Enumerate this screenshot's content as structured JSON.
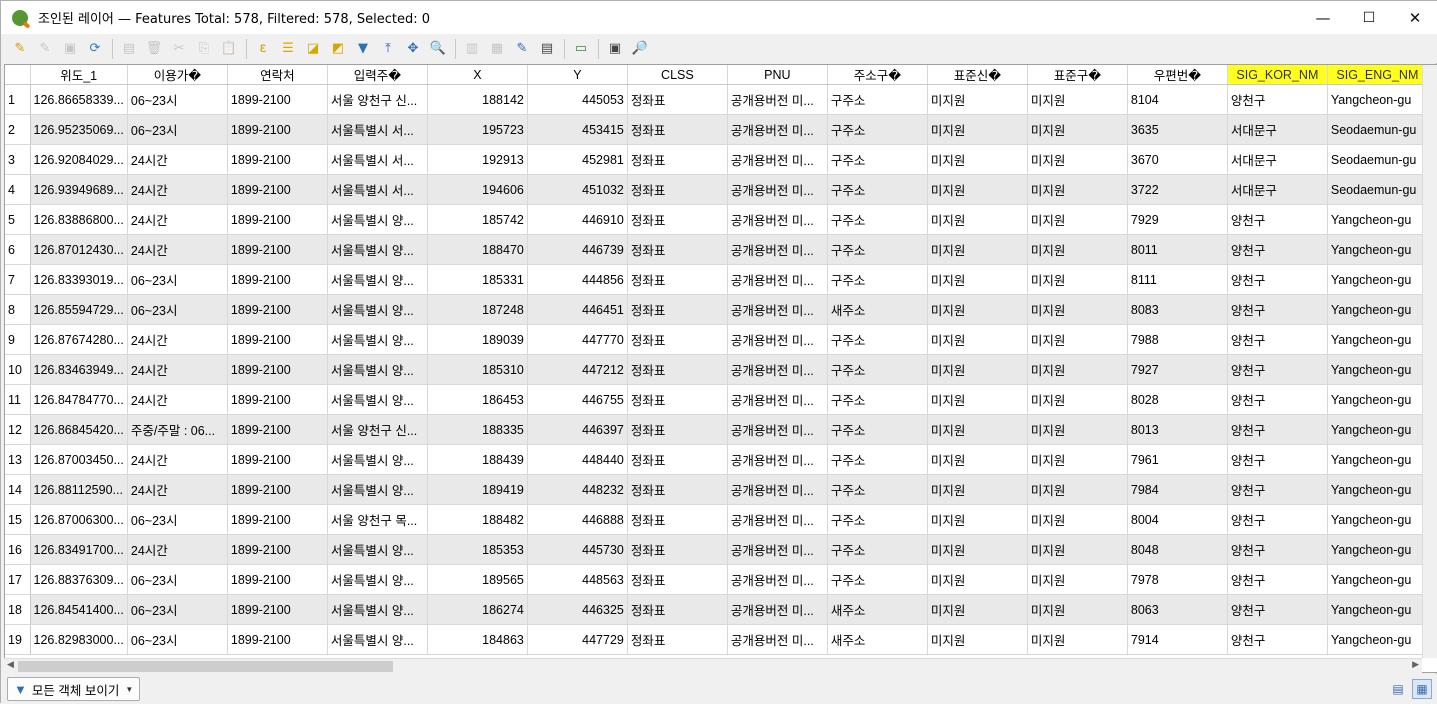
{
  "window": {
    "title": "조인된 레이어 — Features Total: 578, Filtered: 578, Selected: 0",
    "minimize": "—",
    "maximize": "☐",
    "close": "✕"
  },
  "toolbar": {
    "buttons": [
      {
        "name": "toggle-editing-icon",
        "glyph": "✎",
        "color": "#c8a000",
        "dim": false
      },
      {
        "name": "toggle-multi-edit-icon",
        "glyph": "✎",
        "color": "#777777",
        "dim": true
      },
      {
        "name": "save-edits-icon",
        "glyph": "▣",
        "color": "#777777",
        "dim": true
      },
      {
        "name": "reload-table-icon",
        "glyph": "⟳",
        "color": "#2a7ac8",
        "dim": false
      },
      {
        "sep": true
      },
      {
        "name": "add-feature-icon",
        "glyph": "▤",
        "color": "#777777",
        "dim": true
      },
      {
        "name": "delete-feature-icon",
        "glyph": "🗑",
        "color": "#777777",
        "dim": true
      },
      {
        "name": "cut-icon",
        "glyph": "✂",
        "color": "#777777",
        "dim": true
      },
      {
        "name": "copy-icon",
        "glyph": "⎘",
        "color": "#777777",
        "dim": true
      },
      {
        "name": "paste-icon",
        "glyph": "📋",
        "color": "#777777",
        "dim": true
      },
      {
        "sep": true
      },
      {
        "name": "select-by-expression-icon",
        "glyph": "ε",
        "color": "#c89a00",
        "dim": false
      },
      {
        "name": "select-all-icon",
        "glyph": "☰",
        "color": "#d4a800",
        "dim": false
      },
      {
        "name": "invert-selection-icon",
        "glyph": "◪",
        "color": "#d4a800",
        "dim": false
      },
      {
        "name": "deselect-all-icon",
        "glyph": "◩",
        "color": "#d4a800",
        "dim": false
      },
      {
        "name": "filter-select-icon",
        "glyph": "▼",
        "color": "#2d6fb8",
        "dim": false
      },
      {
        "name": "move-selection-top-icon",
        "glyph": "⤒",
        "color": "#2d6fb8",
        "dim": false
      },
      {
        "name": "pan-to-selected-icon",
        "glyph": "✥",
        "color": "#2d6fb8",
        "dim": false
      },
      {
        "name": "zoom-to-selected-icon",
        "glyph": "🔍",
        "color": "#c89a00",
        "dim": false
      },
      {
        "sep": true
      },
      {
        "name": "new-field-icon",
        "glyph": "▥",
        "color": "#777777",
        "dim": true
      },
      {
        "name": "delete-field-icon",
        "glyph": "▦",
        "color": "#777777",
        "dim": true
      },
      {
        "name": "field-calculator-icon",
        "glyph": "✎",
        "color": "#2d6fb8",
        "dim": false
      },
      {
        "name": "conditional-formatting-icon",
        "glyph": "▤",
        "color": "#444444",
        "dim": false
      },
      {
        "sep": true
      },
      {
        "name": "dock-table-icon",
        "glyph": "▭",
        "color": "#3c8a3c",
        "dim": false
      },
      {
        "sep": true
      },
      {
        "name": "actions-icon",
        "glyph": "▣",
        "color": "#444444",
        "dim": false
      },
      {
        "name": "identify-icon",
        "glyph": "🔎",
        "color": "#2d6fb8",
        "dim": false
      }
    ]
  },
  "table": {
    "columns": [
      "위도_1",
      "이용가�",
      "연락처",
      "입력주�",
      "X",
      "Y",
      "CLSS",
      "PNU",
      "주소구�",
      "표준신�",
      "표준구�",
      "우편번�",
      "SIG_KOR_NM",
      "SIG_ENG_NM"
    ],
    "highlighted_columns": [
      12,
      13
    ],
    "highlight_color": "#ffff20",
    "numeric_columns": [
      4,
      5
    ],
    "rows": [
      [
        "1",
        "126.86658339...",
        "06~23시",
        "1899-2100",
        "서울 양천구 신...",
        "188142",
        "445053",
        "정좌표",
        "공개용버전 미...",
        "구주소",
        "미지원",
        "미지원",
        "8104",
        "양천구",
        "Yangcheon-gu"
      ],
      [
        "2",
        "126.95235069...",
        "06~23시",
        "1899-2100",
        "서울특별시 서...",
        "195723",
        "453415",
        "정좌표",
        "공개용버전 미...",
        "구주소",
        "미지원",
        "미지원",
        "3635",
        "서대문구",
        "Seodaemun-gu"
      ],
      [
        "3",
        "126.92084029...",
        "24시간",
        "1899-2100",
        "서울특별시 서...",
        "192913",
        "452981",
        "정좌표",
        "공개용버전 미...",
        "구주소",
        "미지원",
        "미지원",
        "3670",
        "서대문구",
        "Seodaemun-gu"
      ],
      [
        "4",
        "126.93949689...",
        "24시간",
        "1899-2100",
        "서울특별시 서...",
        "194606",
        "451032",
        "정좌표",
        "공개용버전 미...",
        "구주소",
        "미지원",
        "미지원",
        "3722",
        "서대문구",
        "Seodaemun-gu"
      ],
      [
        "5",
        "126.83886800...",
        "24시간",
        "1899-2100",
        "서울특별시 양...",
        "185742",
        "446910",
        "정좌표",
        "공개용버전 미...",
        "구주소",
        "미지원",
        "미지원",
        "7929",
        "양천구",
        "Yangcheon-gu"
      ],
      [
        "6",
        "126.87012430...",
        "24시간",
        "1899-2100",
        "서울특별시 양...",
        "188470",
        "446739",
        "정좌표",
        "공개용버전 미...",
        "구주소",
        "미지원",
        "미지원",
        "8011",
        "양천구",
        "Yangcheon-gu"
      ],
      [
        "7",
        "126.83393019...",
        "06~23시",
        "1899-2100",
        "서울특별시 양...",
        "185331",
        "444856",
        "정좌표",
        "공개용버전 미...",
        "구주소",
        "미지원",
        "미지원",
        "8111",
        "양천구",
        "Yangcheon-gu"
      ],
      [
        "8",
        "126.85594729...",
        "06~23시",
        "1899-2100",
        "서울특별시 양...",
        "187248",
        "446451",
        "정좌표",
        "공개용버전 미...",
        "새주소",
        "미지원",
        "미지원",
        "8083",
        "양천구",
        "Yangcheon-gu"
      ],
      [
        "9",
        "126.87674280...",
        "24시간",
        "1899-2100",
        "서울특별시 양...",
        "189039",
        "447770",
        "정좌표",
        "공개용버전 미...",
        "구주소",
        "미지원",
        "미지원",
        "7988",
        "양천구",
        "Yangcheon-gu"
      ],
      [
        "10",
        "126.83463949...",
        "24시간",
        "1899-2100",
        "서울특별시 양...",
        "185310",
        "447212",
        "정좌표",
        "공개용버전 미...",
        "구주소",
        "미지원",
        "미지원",
        "7927",
        "양천구",
        "Yangcheon-gu"
      ],
      [
        "11",
        "126.84784770...",
        "24시간",
        "1899-2100",
        "서울특별시 양...",
        "186453",
        "446755",
        "정좌표",
        "공개용버전 미...",
        "구주소",
        "미지원",
        "미지원",
        "8028",
        "양천구",
        "Yangcheon-gu"
      ],
      [
        "12",
        "126.86845420...",
        "주중/주말 : 06...",
        "1899-2100",
        "서울 양천구 신...",
        "188335",
        "446397",
        "정좌표",
        "공개용버전 미...",
        "구주소",
        "미지원",
        "미지원",
        "8013",
        "양천구",
        "Yangcheon-gu"
      ],
      [
        "13",
        "126.87003450...",
        "24시간",
        "1899-2100",
        "서울특별시 양...",
        "188439",
        "448440",
        "정좌표",
        "공개용버전 미...",
        "구주소",
        "미지원",
        "미지원",
        "7961",
        "양천구",
        "Yangcheon-gu"
      ],
      [
        "14",
        "126.88112590...",
        "24시간",
        "1899-2100",
        "서울특별시 양...",
        "189419",
        "448232",
        "정좌표",
        "공개용버전 미...",
        "구주소",
        "미지원",
        "미지원",
        "7984",
        "양천구",
        "Yangcheon-gu"
      ],
      [
        "15",
        "126.87006300...",
        "06~23시",
        "1899-2100",
        "서울 양천구 목...",
        "188482",
        "446888",
        "정좌표",
        "공개용버전 미...",
        "구주소",
        "미지원",
        "미지원",
        "8004",
        "양천구",
        "Yangcheon-gu"
      ],
      [
        "16",
        "126.83491700...",
        "24시간",
        "1899-2100",
        "서울특별시 양...",
        "185353",
        "445730",
        "정좌표",
        "공개용버전 미...",
        "구주소",
        "미지원",
        "미지원",
        "8048",
        "양천구",
        "Yangcheon-gu"
      ],
      [
        "17",
        "126.88376309...",
        "06~23시",
        "1899-2100",
        "서울특별시 양...",
        "189565",
        "448563",
        "정좌표",
        "공개용버전 미...",
        "구주소",
        "미지원",
        "미지원",
        "7978",
        "양천구",
        "Yangcheon-gu"
      ],
      [
        "18",
        "126.84541400...",
        "06~23시",
        "1899-2100",
        "서울특별시 양...",
        "186274",
        "446325",
        "정좌표",
        "공개용버전 미...",
        "새주소",
        "미지원",
        "미지원",
        "8063",
        "양천구",
        "Yangcheon-gu"
      ],
      [
        "19",
        "126.82983000...",
        "06~23시",
        "1899-2100",
        "서울특별시 양...",
        "184863",
        "447729",
        "정좌표",
        "공개용버전 미...",
        "새주소",
        "미지원",
        "미지원",
        "7914",
        "양천구",
        "Yangcheon-gu"
      ]
    ]
  },
  "bottom": {
    "filter_label": "모든 객체 보이기",
    "form_view_icon": "form-view-icon",
    "table_view_icon": "table-view-icon"
  }
}
